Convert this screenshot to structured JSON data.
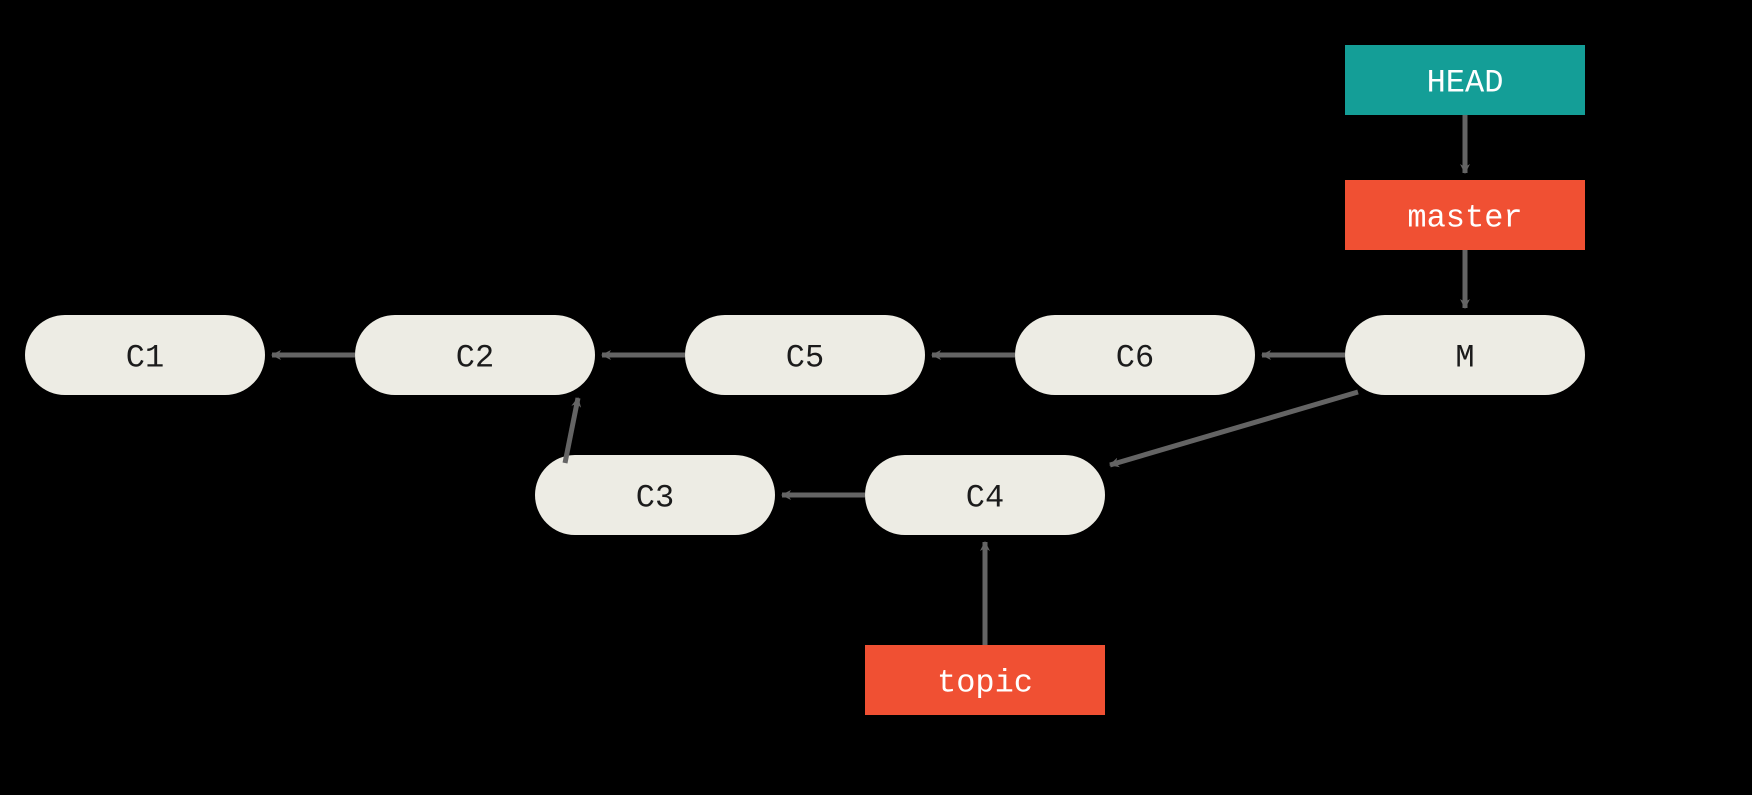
{
  "colors": {
    "commit_fill": "#EDECE4",
    "head_fill": "#149E97",
    "branch_fill": "#F05033",
    "arrow": "#646464",
    "bg": "#000000"
  },
  "commits": {
    "c1": "C1",
    "c2": "C2",
    "c5": "C5",
    "c6": "C6",
    "m": "M",
    "c3": "C3",
    "c4": "C4"
  },
  "refs": {
    "head": "HEAD",
    "master": "master",
    "topic": "topic"
  }
}
